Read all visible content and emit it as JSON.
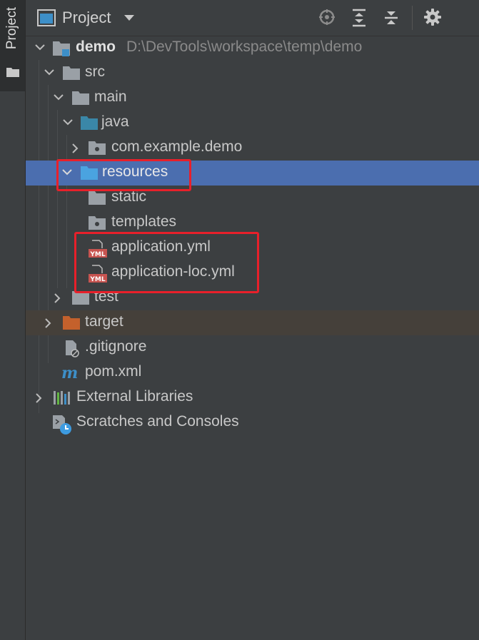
{
  "sidebar": {
    "tab_label": "Project"
  },
  "header": {
    "title": "Project",
    "buttons": [
      "locate-icon",
      "expand-all-icon",
      "collapse-all-icon",
      "gear-icon"
    ]
  },
  "tree": {
    "project": {
      "name": "demo",
      "path": "D:\\DevTools\\workspace\\temp\\demo"
    },
    "src": "src",
    "main": "main",
    "java": "java",
    "package": "com.example.demo",
    "resources": "resources",
    "static": "static",
    "templates": "templates",
    "application_yml": "application.yml",
    "application_loc_yml": "application-loc.yml",
    "test": "test",
    "target": "target",
    "gitignore": ".gitignore",
    "pom": "pom.xml",
    "external_libraries": "External Libraries",
    "scratches": "Scratches and Consoles"
  },
  "colors": {
    "selection": "#4b6eaf",
    "excluded_row": "#45403a",
    "highlight_box": "#e8202a",
    "folder_gray": "#9aa0a6",
    "folder_blue": "#3d8fc8",
    "folder_teal": "#3a87a8",
    "folder_orange": "#c4612c"
  }
}
